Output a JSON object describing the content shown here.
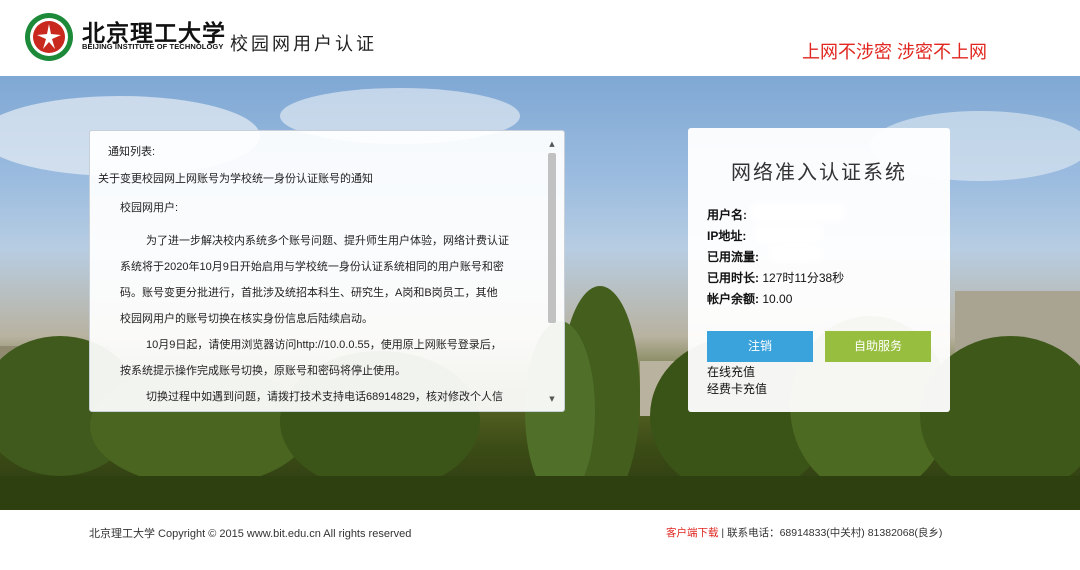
{
  "header": {
    "school_name_cn": "北京理工大学",
    "school_name_en": "BEIJING INSTITUTE OF TECHNOLOGY",
    "system_title": "校园网用户认证",
    "slogan": "上网不涉密 涉密不上网"
  },
  "notice": {
    "lines": [
      "通知列表:",
      "关于变更校园网上网账号为学校统一身份认证账号的通知",
      "校园网用户:",
      "为了进一步解决校内系统多个账号问题、提升师生用户体验，网络计费认证",
      "系统将于2020年10月9日开始启用与学校统一身份认证系统相同的用户账号和密",
      "码。账号变更分批进行，首批涉及统招本科生、研究生，A岗和B岗员工，其他",
      "校园网用户的账号切换在核实身份信息后陆续启动。",
      "10月9日起，请使用浏览器访问http://10.0.0.55，使用原上网账号登录后，",
      "按系统提示操作完成账号切换，原账号和密码将停止使用。",
      "切换过程中如遇到问题，请拨打技术支持电话68914829，核对修改个人信"
    ]
  },
  "login": {
    "title": "网络准入认证系统",
    "fields": [
      {
        "label": "用户名:",
        "value": ""
      },
      {
        "label": "IP地址:",
        "value": ""
      },
      {
        "label": "已用流量:",
        "value": ""
      },
      {
        "label": "已用时长:",
        "value": "127时11分38秒"
      },
      {
        "label": "帐户余额:",
        "value": "10.00"
      }
    ],
    "logout_label": "注销",
    "self_service_label": "自助服务",
    "online_recharge": "在线充值",
    "card_recharge": "经费卡充值"
  },
  "footer": {
    "copyright": "北京理工大学 Copyright © 2015 www.bit.edu.cn All rights reserved",
    "client_download": "客户端下载",
    "separator": "|",
    "contact": "联系电话：68914833(中关村) 81382068(良乡)"
  },
  "colors": {
    "slogan_red": "#e0261f",
    "logout_blue": "#3aa3dc",
    "self_service_green": "#97be3e"
  }
}
